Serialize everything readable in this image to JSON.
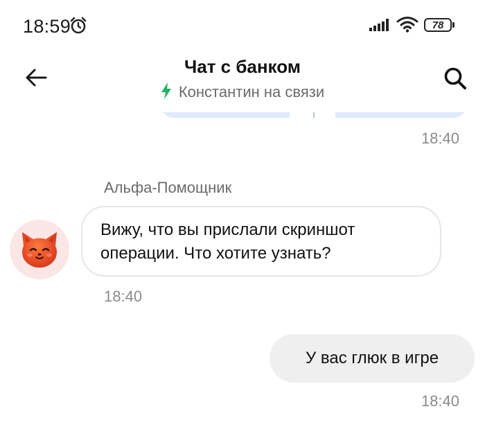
{
  "status_bar": {
    "time": "18:59",
    "battery": "78"
  },
  "header": {
    "title": "Чат с банком",
    "subtitle": "Константин на связи"
  },
  "messages": [
    {
      "type": "outgoing-clipped",
      "time": "18:40"
    },
    {
      "type": "incoming",
      "sender": "Альфа-Помощник",
      "text": "Вижу, что вы прислали скриншот операции. Что хотите узнать?",
      "time": "18:40"
    },
    {
      "type": "outgoing",
      "text": "У вас глюк в игре",
      "time": "18:40"
    }
  ],
  "colors": {
    "accent_green": "#22b35e",
    "outgoing_bubble_blue": "#dfe9fb",
    "user_bubble_gray": "#efefef",
    "avatar_bg": "#fbe6e6",
    "avatar_cat": "#e8491d"
  },
  "icons": {
    "back": "arrow-left-icon",
    "search": "search-icon",
    "alarm": "alarm-clock-icon",
    "signal": "signal-bars-icon",
    "wifi": "wifi-icon",
    "online": "lightning-bolt-icon",
    "avatar": "cat-face-icon"
  }
}
